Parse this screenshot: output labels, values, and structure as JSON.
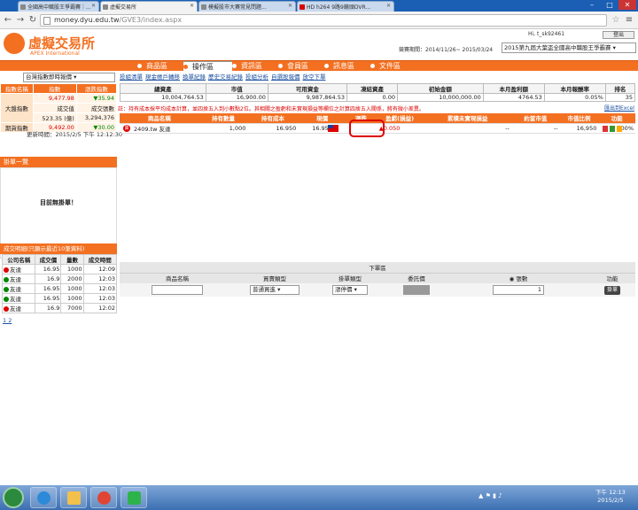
{
  "browser": {
    "tabs": [
      "全國高中職股王爭霸賽｜...",
      "虛擬交易所",
      "模擬股市大賽常見問題...",
      "HD h264 9路9鏡頭DVR..."
    ],
    "url_host": "money.dyu.edu.tw",
    "url_path": "/GVE3/index.aspx"
  },
  "header": {
    "logo_title": "虛擬交易所",
    "logo_subtitle": "APEX International",
    "greeting": "Hi, t_sk92461",
    "logout_label": "登出",
    "period_label": "競賽期間：2014/11/26~ 2015/03/24",
    "contest_selected": "2015第九屆大葉盃全國高中職股王爭霸賽"
  },
  "nav": [
    "商品區",
    "操作區",
    "資訊區",
    "會員區",
    "訊息區",
    "文件區"
  ],
  "subnav": [
    "投組清單",
    "現金帳戶轉移",
    "換單紀錄",
    "歷史交易紀錄",
    "投組分析",
    "自選股報價",
    "放空下單"
  ],
  "index_panel": {
    "selected": "台灣指數即時報價",
    "headers": [
      "指數名稱",
      "指數",
      "漲跌指數"
    ],
    "rows": [
      {
        "name": "大盤指數",
        "c1": "9,477.98",
        "c2": "▼35.94"
      },
      {
        "name": "",
        "c1": "成交值",
        "c2": "成交張數"
      },
      {
        "name": "",
        "c1": "523.35 (億)",
        "c2": "3,294,376"
      },
      {
        "name": "期貨指數",
        "c1": "9,492.00",
        "c2": "▼30.00"
      }
    ],
    "update_time": "更新時間：2015/2/5 下午 12:12:30"
  },
  "account": {
    "headers": [
      "總資產",
      "市值",
      "可用資金",
      "凍結資產",
      "初始金額",
      "本月盈利額",
      "本月報酬率",
      "排名"
    ],
    "values": [
      "10,004,764.53",
      "16,900.00",
      "9,987,864.53",
      "0.00",
      "10,000,000.00",
      "4764.53",
      "0.05%",
      "35"
    ]
  },
  "note": "註：持有成本採平均成本計算，並四捨五入到小數點2位。其相關之盈虧和未實現損益等欄位之計算四捨五入關係，將有微小差異。",
  "print_link": "匯出到Excel",
  "holdings": {
    "headers": [
      "商品名稱",
      "持有數量",
      "持有成本",
      "現價",
      "漲跌",
      "盈虧(損益)",
      "累積未實現損益",
      "約當市值",
      "市值比例",
      "功能"
    ],
    "row": {
      "name": "2409.tw 友達",
      "qty": "1,000",
      "cost": "16.950",
      "price": "16.950",
      "change": "▲0.050",
      "pl": "--",
      "unreal": "--",
      "mv": "16,950",
      "ratio": "100%"
    }
  },
  "pending": {
    "title": "掛單一覽",
    "empty_text": "目前無掛單！"
  },
  "trades": {
    "title": "成交明細(只顯示最近10筆資料)",
    "headers": [
      "公司名稱",
      "成交價",
      "量數",
      "成交時間"
    ],
    "rows": [
      {
        "name": "友達",
        "price": "16.95",
        "qty": "1000",
        "time": "12:09"
      },
      {
        "name": "友達",
        "price": "16.9",
        "qty": "2000",
        "time": "12:03"
      },
      {
        "name": "友達",
        "price": "16.95",
        "qty": "1000",
        "time": "12:03"
      },
      {
        "name": "友達",
        "price": "16.95",
        "qty": "1000",
        "time": "12:03"
      },
      {
        "name": "友達",
        "price": "16.9",
        "qty": "7000",
        "time": "12:02"
      }
    ],
    "pages": "1 2"
  },
  "order": {
    "title": "下單區",
    "headers": [
      "商品名稱",
      "買賣類型",
      "掛單類型",
      "委託價",
      "張數",
      "功能"
    ],
    "trade_type": "普通買進",
    "order_type": "漲停價",
    "qty": "1",
    "submit": "掛單"
  },
  "taskbar": {
    "time": "下午 12:13",
    "date": "2015/2/5"
  }
}
